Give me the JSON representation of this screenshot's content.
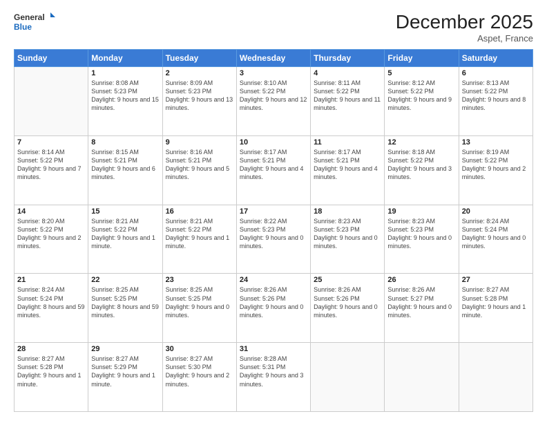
{
  "header": {
    "logo": {
      "general": "General",
      "blue": "Blue"
    },
    "title": "December 2025",
    "location": "Aspet, France"
  },
  "days_of_week": [
    "Sunday",
    "Monday",
    "Tuesday",
    "Wednesday",
    "Thursday",
    "Friday",
    "Saturday"
  ],
  "weeks": [
    [
      {
        "num": "",
        "empty": true
      },
      {
        "num": "1",
        "sunrise": "Sunrise: 8:08 AM",
        "sunset": "Sunset: 5:23 PM",
        "daylight": "Daylight: 9 hours and 15 minutes."
      },
      {
        "num": "2",
        "sunrise": "Sunrise: 8:09 AM",
        "sunset": "Sunset: 5:23 PM",
        "daylight": "Daylight: 9 hours and 13 minutes."
      },
      {
        "num": "3",
        "sunrise": "Sunrise: 8:10 AM",
        "sunset": "Sunset: 5:22 PM",
        "daylight": "Daylight: 9 hours and 12 minutes."
      },
      {
        "num": "4",
        "sunrise": "Sunrise: 8:11 AM",
        "sunset": "Sunset: 5:22 PM",
        "daylight": "Daylight: 9 hours and 11 minutes."
      },
      {
        "num": "5",
        "sunrise": "Sunrise: 8:12 AM",
        "sunset": "Sunset: 5:22 PM",
        "daylight": "Daylight: 9 hours and 9 minutes."
      },
      {
        "num": "6",
        "sunrise": "Sunrise: 8:13 AM",
        "sunset": "Sunset: 5:22 PM",
        "daylight": "Daylight: 9 hours and 8 minutes."
      }
    ],
    [
      {
        "num": "7",
        "sunrise": "Sunrise: 8:14 AM",
        "sunset": "Sunset: 5:22 PM",
        "daylight": "Daylight: 9 hours and 7 minutes."
      },
      {
        "num": "8",
        "sunrise": "Sunrise: 8:15 AM",
        "sunset": "Sunset: 5:21 PM",
        "daylight": "Daylight: 9 hours and 6 minutes."
      },
      {
        "num": "9",
        "sunrise": "Sunrise: 8:16 AM",
        "sunset": "Sunset: 5:21 PM",
        "daylight": "Daylight: 9 hours and 5 minutes."
      },
      {
        "num": "10",
        "sunrise": "Sunrise: 8:17 AM",
        "sunset": "Sunset: 5:21 PM",
        "daylight": "Daylight: 9 hours and 4 minutes."
      },
      {
        "num": "11",
        "sunrise": "Sunrise: 8:17 AM",
        "sunset": "Sunset: 5:21 PM",
        "daylight": "Daylight: 9 hours and 4 minutes."
      },
      {
        "num": "12",
        "sunrise": "Sunrise: 8:18 AM",
        "sunset": "Sunset: 5:22 PM",
        "daylight": "Daylight: 9 hours and 3 minutes."
      },
      {
        "num": "13",
        "sunrise": "Sunrise: 8:19 AM",
        "sunset": "Sunset: 5:22 PM",
        "daylight": "Daylight: 9 hours and 2 minutes."
      }
    ],
    [
      {
        "num": "14",
        "sunrise": "Sunrise: 8:20 AM",
        "sunset": "Sunset: 5:22 PM",
        "daylight": "Daylight: 9 hours and 2 minutes."
      },
      {
        "num": "15",
        "sunrise": "Sunrise: 8:21 AM",
        "sunset": "Sunset: 5:22 PM",
        "daylight": "Daylight: 9 hours and 1 minute."
      },
      {
        "num": "16",
        "sunrise": "Sunrise: 8:21 AM",
        "sunset": "Sunset: 5:22 PM",
        "daylight": "Daylight: 9 hours and 1 minute."
      },
      {
        "num": "17",
        "sunrise": "Sunrise: 8:22 AM",
        "sunset": "Sunset: 5:23 PM",
        "daylight": "Daylight: 9 hours and 0 minutes."
      },
      {
        "num": "18",
        "sunrise": "Sunrise: 8:23 AM",
        "sunset": "Sunset: 5:23 PM",
        "daylight": "Daylight: 9 hours and 0 minutes."
      },
      {
        "num": "19",
        "sunrise": "Sunrise: 8:23 AM",
        "sunset": "Sunset: 5:23 PM",
        "daylight": "Daylight: 9 hours and 0 minutes."
      },
      {
        "num": "20",
        "sunrise": "Sunrise: 8:24 AM",
        "sunset": "Sunset: 5:24 PM",
        "daylight": "Daylight: 9 hours and 0 minutes."
      }
    ],
    [
      {
        "num": "21",
        "sunrise": "Sunrise: 8:24 AM",
        "sunset": "Sunset: 5:24 PM",
        "daylight": "Daylight: 8 hours and 59 minutes."
      },
      {
        "num": "22",
        "sunrise": "Sunrise: 8:25 AM",
        "sunset": "Sunset: 5:25 PM",
        "daylight": "Daylight: 8 hours and 59 minutes."
      },
      {
        "num": "23",
        "sunrise": "Sunrise: 8:25 AM",
        "sunset": "Sunset: 5:25 PM",
        "daylight": "Daylight: 9 hours and 0 minutes."
      },
      {
        "num": "24",
        "sunrise": "Sunrise: 8:26 AM",
        "sunset": "Sunset: 5:26 PM",
        "daylight": "Daylight: 9 hours and 0 minutes."
      },
      {
        "num": "25",
        "sunrise": "Sunrise: 8:26 AM",
        "sunset": "Sunset: 5:26 PM",
        "daylight": "Daylight: 9 hours and 0 minutes."
      },
      {
        "num": "26",
        "sunrise": "Sunrise: 8:26 AM",
        "sunset": "Sunset: 5:27 PM",
        "daylight": "Daylight: 9 hours and 0 minutes."
      },
      {
        "num": "27",
        "sunrise": "Sunrise: 8:27 AM",
        "sunset": "Sunset: 5:28 PM",
        "daylight": "Daylight: 9 hours and 1 minute."
      }
    ],
    [
      {
        "num": "28",
        "sunrise": "Sunrise: 8:27 AM",
        "sunset": "Sunset: 5:28 PM",
        "daylight": "Daylight: 9 hours and 1 minute."
      },
      {
        "num": "29",
        "sunrise": "Sunrise: 8:27 AM",
        "sunset": "Sunset: 5:29 PM",
        "daylight": "Daylight: 9 hours and 1 minute."
      },
      {
        "num": "30",
        "sunrise": "Sunrise: 8:27 AM",
        "sunset": "Sunset: 5:30 PM",
        "daylight": "Daylight: 9 hours and 2 minutes."
      },
      {
        "num": "31",
        "sunrise": "Sunrise: 8:28 AM",
        "sunset": "Sunset: 5:31 PM",
        "daylight": "Daylight: 9 hours and 3 minutes."
      },
      {
        "num": "",
        "empty": true
      },
      {
        "num": "",
        "empty": true
      },
      {
        "num": "",
        "empty": true
      }
    ]
  ]
}
